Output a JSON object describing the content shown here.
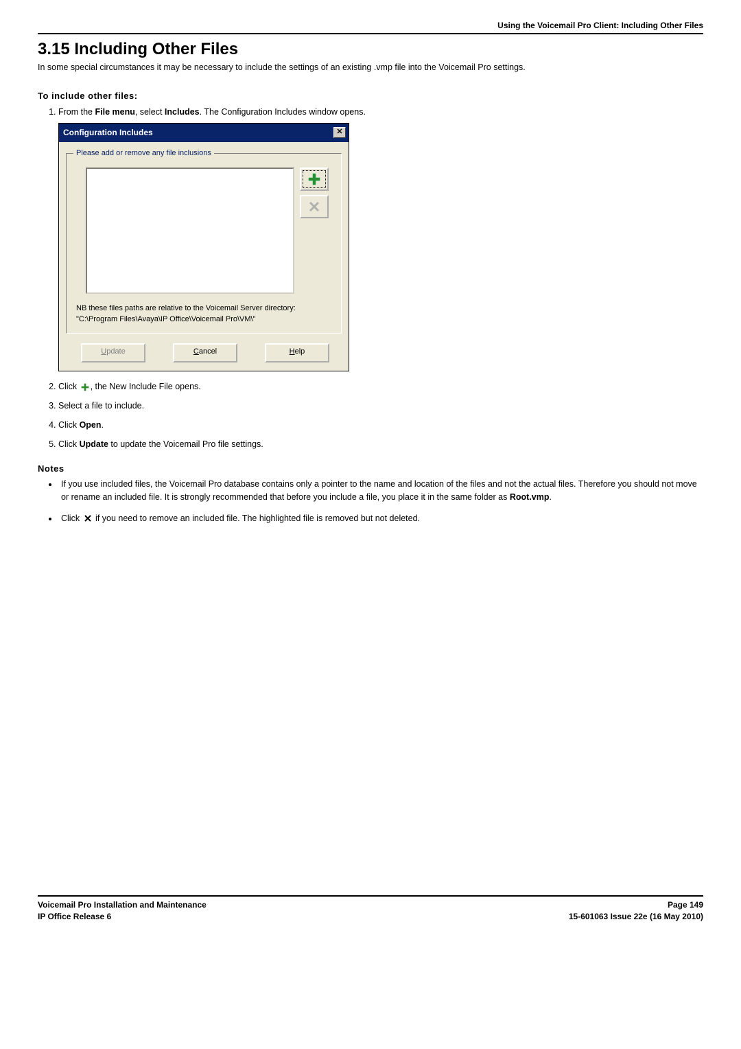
{
  "header": {
    "crumb": "Using the Voicemail Pro Client: Including Other Files"
  },
  "section": {
    "number_title": "3.15 Including Other Files",
    "intro": "In some special circumstances it may be necessary to include the settings of an existing .vmp file into the Voicemail Pro settings.",
    "to_include": "To include other files:",
    "steps": {
      "s1a": "From the ",
      "s1b": "File menu",
      "s1c": ", select ",
      "s1d": "Includes",
      "s1e": ". The Configuration Includes window opens.",
      "s2a": "Click ",
      "s2b": ", the New Include File opens.",
      "s3": "Select a file to include.",
      "s4a": "Click ",
      "s4b": "Open",
      "s4c": ".",
      "s5a": "Click ",
      "s5b": "Update",
      "s5c": " to update the Voicemail Pro file settings."
    },
    "notes_label": "Notes",
    "notes": {
      "n1": "If you use included files, the Voicemail Pro database contains only a pointer to the name and location of the files and not the actual files. Therefore you should not move or rename an included file. It is strongly recommended that before you include a file, you place it in the same folder as ",
      "n1b": "Root.vmp",
      "n1c": ".",
      "n2a": "Click ",
      "n2b": " if you need to remove an included file. The highlighted file is removed but not deleted."
    }
  },
  "dialog": {
    "title": "Configuration Includes",
    "legend": "Please add or remove any file inclusions",
    "nb": "NB these files paths are relative to the Voicemail Server directory:\n\"C:\\Program Files\\Avaya\\IP Office\\Voicemail Pro\\VM\\\"",
    "buttons": {
      "update": "Update",
      "update_u": "U",
      "cancel": "ancel",
      "cancel_u": "C",
      "help": "elp",
      "help_u": "H"
    }
  },
  "footer": {
    "l1": "Voicemail Pro Installation and Maintenance",
    "l2": "IP Office Release 6",
    "r1": "Page 149",
    "r2": "15-601063 Issue 22e (16 May 2010)"
  }
}
